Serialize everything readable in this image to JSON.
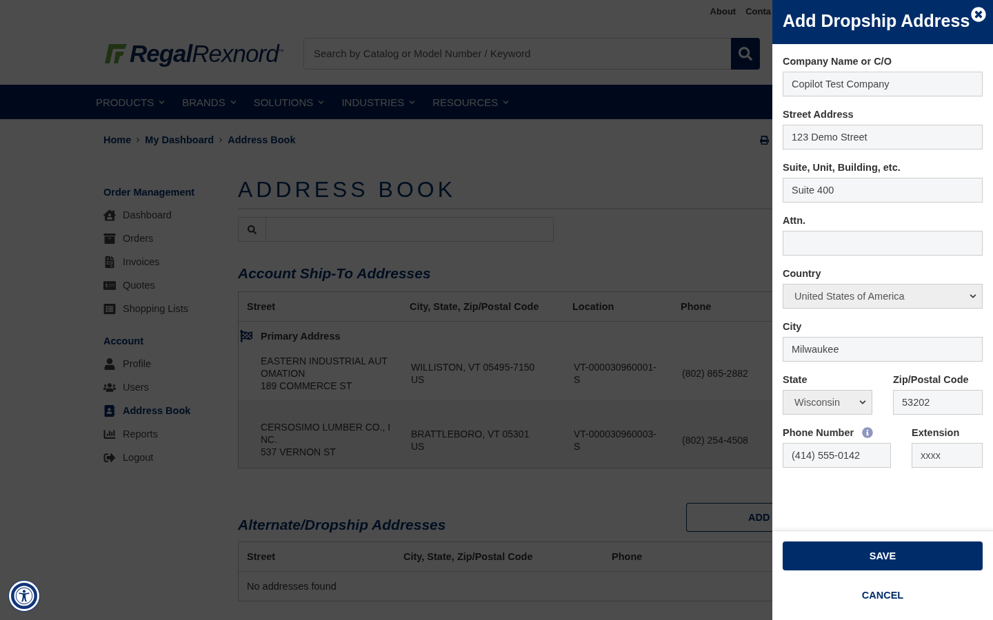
{
  "top_links": [
    "About",
    "Conta"
  ],
  "logo": "**Regal**Rexnord$^{™}$",
  "site_search": {
    "placeholder": "Search by Catalog or Model Number / Keyword"
  },
  "nav": [
    {
      "label": "PRODUCTS"
    },
    {
      "label": "BRANDS"
    },
    {
      "label": "SOLUTIONS"
    },
    {
      "label": "INDUSTRIES"
    },
    {
      "label": "RESOURCES"
    }
  ],
  "breadcrumb": [
    "Home",
    "My Dashboard",
    "Address Book"
  ],
  "sidebar": {
    "sections": [
      {
        "title": "Order Management",
        "items": [
          {
            "label": "Dashboard",
            "selected": false
          },
          {
            "label": "Orders",
            "selected": false
          },
          {
            "label": "Invoices",
            "selected": false
          },
          {
            "label": "Quotes",
            "selected": false
          },
          {
            "label": "Shopping Lists",
            "selected": false
          }
        ]
      },
      {
        "title": "Account",
        "items": [
          {
            "label": "Profile",
            "selected": false
          },
          {
            "label": "Users",
            "selected": false
          },
          {
            "label": "Address Book",
            "selected": true
          },
          {
            "label": "Reports",
            "selected": false
          },
          {
            "label": "Logout",
            "selected": false
          }
        ]
      }
    ]
  },
  "page_title": "ADDRESS BOOK",
  "ship_to": {
    "heading": "Account Ship-To Addresses",
    "columns": [
      "Street",
      "City, State, Zip/Postal Code",
      "Location",
      "Phone"
    ],
    "rows": [
      {
        "badge": "Primary Address",
        "street": [
          "EASTERN INDUSTRIAL AUTOMATION",
          "189 COMMERCE ST"
        ],
        "city": [
          "WILLISTON, VT 05495-7150",
          "US"
        ],
        "location": "VT-000030960001-S",
        "phone": "(802) 865-2882"
      },
      {
        "street": [
          "CERSOSIMO LUMBER CO., INC.",
          "537 VERNON ST"
        ],
        "city": [
          "BRATTLEBORO, VT 05301",
          "US"
        ],
        "location": "VT-000030960003-S",
        "phone": "(802) 254-4508"
      }
    ]
  },
  "dropship": {
    "heading": "Alternate/Dropship Addresses",
    "add_button": "ADD",
    "columns": [
      "Street",
      "City, State, Zip/Postal Code",
      "Phone"
    ],
    "empty": "No addresses found"
  },
  "drawer": {
    "title": "Add Dropship Address",
    "rows": [
      [
        {
          "label": "Company Name or C/O",
          "kind": "input",
          "value": "Copilot Test Company"
        }
      ],
      [
        {
          "label": "Street Address",
          "kind": "input",
          "value": "123 Demo Street"
        }
      ],
      [
        {
          "label": "Suite, Unit, Building, etc.",
          "kind": "input",
          "value": "Suite 400"
        }
      ],
      [
        {
          "label": "Attn.",
          "kind": "input"
        }
      ],
      [
        {
          "label": "Country",
          "kind": "select",
          "value": "United States of America"
        }
      ],
      [
        {
          "label": "City",
          "kind": "input",
          "value": "Milwaukee"
        }
      ],
      [
        {
          "label": "State",
          "kind": "select",
          "value": "Wisconsin"
        },
        {
          "label": "Zip/Postal Code",
          "kind": "input",
          "value": "53202"
        }
      ],
      [
        {
          "label": "Phone Number",
          "kind": "input",
          "value": "(414) 555-0142",
          "info": true
        },
        {
          "label": "Extension",
          "kind": "input",
          "placeholder": "xxxx"
        }
      ]
    ],
    "save": "SAVE",
    "cancel": "CANCEL"
  }
}
